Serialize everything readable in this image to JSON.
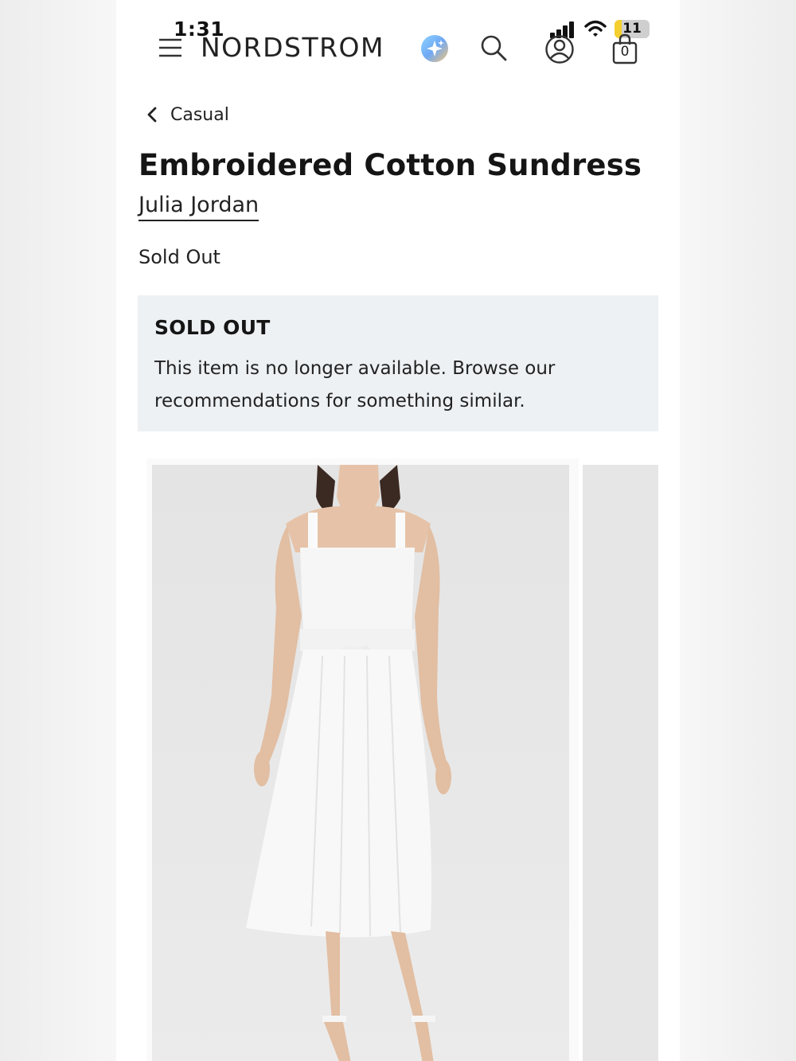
{
  "status_bar": {
    "time": "1:31",
    "battery_level": "11"
  },
  "header": {
    "logo": "NORDSTROM",
    "bag_count": "0"
  },
  "breadcrumb": {
    "back_label": "Casual"
  },
  "product": {
    "title": "Embroidered Cotton Sundress",
    "brand": "Julia Jordan",
    "price_status": "Sold Out"
  },
  "notice": {
    "title": "SOLD OUT",
    "body": "This item is no longer available. Browse our recommendations for something similar."
  },
  "colors": {
    "notice_background": "#eef1f4",
    "battery_fill": "#f4cf2f",
    "text": "#1a1a1a"
  },
  "icons": [
    "menu-icon",
    "ai-sparkle-icon",
    "search-icon",
    "account-icon",
    "bag-icon",
    "chevron-left-icon",
    "signal-icon",
    "wifi-icon",
    "battery-icon"
  ]
}
